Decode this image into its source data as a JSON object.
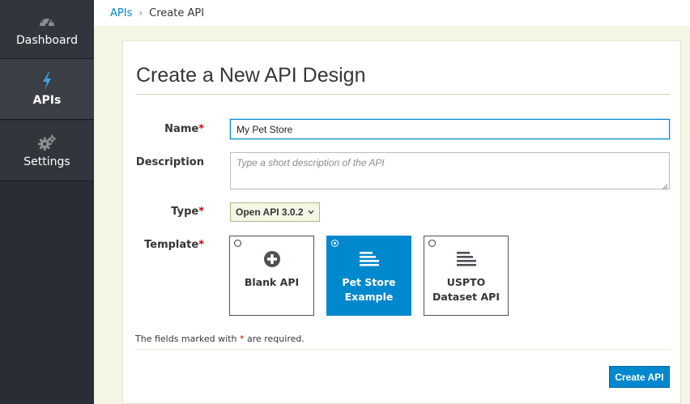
{
  "sidebar": {
    "items": [
      {
        "label": "Dashboard",
        "icon": "dashboard-icon"
      },
      {
        "label": "APIs",
        "icon": "bolt-icon",
        "active": true
      },
      {
        "label": "Settings",
        "icon": "gears-icon"
      }
    ]
  },
  "breadcrumb": {
    "parent": "APIs",
    "separator": "›",
    "current": "Create API"
  },
  "form": {
    "title": "Create a New API Design",
    "name_label": "Name",
    "name_value": "My Pet Store",
    "description_label": "Description",
    "description_placeholder": "Type a short description of the API",
    "type_label": "Type",
    "type_value": "Open API 3.0.2",
    "template_label": "Template",
    "required_mark": "*",
    "templates": [
      {
        "label": "Blank API",
        "icon": "plus-circle-icon",
        "selected": false
      },
      {
        "label": "Pet Store Example",
        "icon": "list-lines-icon",
        "selected": true
      },
      {
        "label": "USPTO Dataset API",
        "icon": "list-lines-icon",
        "selected": false
      }
    ],
    "note_prefix": "The fields marked with",
    "note_suffix": "are required.",
    "submit_label": "Create API"
  },
  "colors": {
    "accent": "#0088ce",
    "required": "#cc0000",
    "sidebar_bg": "#292e34"
  }
}
